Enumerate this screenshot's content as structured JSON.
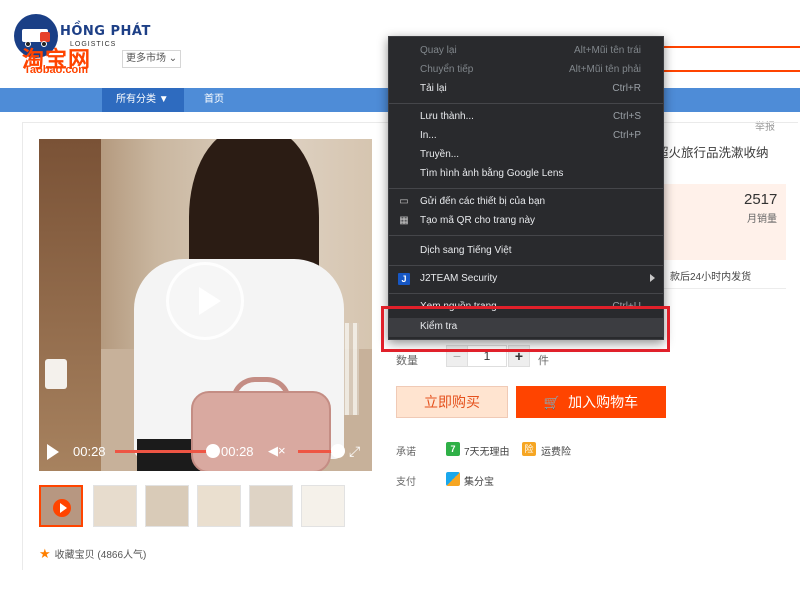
{
  "header": {
    "brand_name": "HỒNG PHÁT",
    "brand_sub": "LOGISTICS",
    "taobao_chinese": "淘宝网",
    "taobao_domain": "Taobao.com",
    "market_select": "更多市场 ⌄"
  },
  "nav": {
    "category": "所有分类 ▼",
    "home": "首页"
  },
  "report": "举报",
  "product": {
    "title_fragment": "超火旅行品洗漱收纳",
    "sales_count": "2517",
    "sales_label": "月销量",
    "shipping": "款后24小时内发货",
    "quantity_label": "数量",
    "quantity_value": "1",
    "quantity_minus": "−",
    "quantity_plus": "+",
    "quantity_unit": "件",
    "buy_now": "立即购买",
    "add_to_cart": "加入购物车",
    "promise_label": "承诺",
    "promise_badge": "7",
    "promise_7days": "7天无理由",
    "promise_insurance": "运费险",
    "payment_label": "支付",
    "payment_method": "集分宝",
    "favorite": "收藏宝贝 (4866人气)"
  },
  "video": {
    "time_current": "00:28",
    "time_total": "00:28"
  },
  "context_menu": {
    "items": [
      {
        "label": "Quay lại",
        "shortcut": "Alt+Mũi tên trái",
        "disabled": true
      },
      {
        "label": "Chuyển tiếp",
        "shortcut": "Alt+Mũi tên phải",
        "disabled": true
      },
      {
        "label": "Tải lại",
        "shortcut": "Ctrl+R",
        "disabled": false
      },
      {
        "label": "Lưu thành...",
        "shortcut": "Ctrl+S",
        "disabled": false
      },
      {
        "label": "In...",
        "shortcut": "Ctrl+P",
        "disabled": false
      },
      {
        "label": "Truyền...",
        "shortcut": "",
        "disabled": false
      },
      {
        "label": "Tìm hình ảnh bằng Google Lens",
        "shortcut": "",
        "disabled": false
      },
      {
        "label": "Gửi đến các thiết bị của bạn",
        "shortcut": "",
        "disabled": false
      },
      {
        "label": "Tạo mã QR cho trang này",
        "shortcut": "",
        "disabled": false
      },
      {
        "label": "Dịch sang Tiếng Việt",
        "shortcut": "",
        "disabled": false
      },
      {
        "label": "J2TEAM Security",
        "shortcut": "",
        "disabled": false
      },
      {
        "label": "Xem nguồn trang",
        "shortcut": "Ctrl+U",
        "disabled": false
      },
      {
        "label": "Kiểm tra",
        "shortcut": "",
        "disabled": false
      }
    ]
  },
  "colors": {
    "accent": "#ff4400",
    "nav_blue": "#4e8cd7",
    "menu_bg": "#292a2d",
    "highlight_box": "#e0202a"
  },
  "icons": {
    "send_to_devices": "device-icon",
    "qr": "qr-code-icon",
    "j2team": "j2team-icon",
    "cart": "cart-icon"
  }
}
